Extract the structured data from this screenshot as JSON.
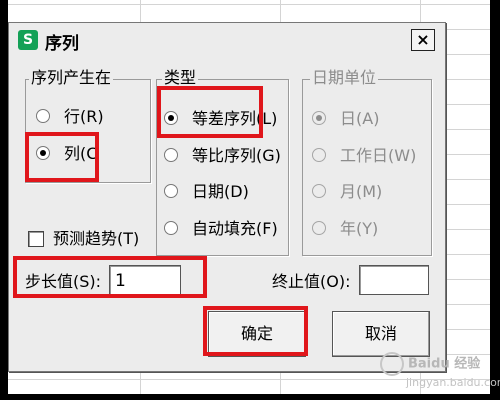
{
  "dialog": {
    "icon_letter": "S",
    "title": "序列",
    "close_glyph": "×"
  },
  "series_in": {
    "legend": "序列产生在",
    "options": [
      {
        "label": "行(R)",
        "checked": false
      },
      {
        "label": "列(C",
        "checked": true
      }
    ]
  },
  "type": {
    "legend": "类型",
    "options": [
      {
        "label": "等差序列(L)",
        "checked": true
      },
      {
        "label": "等比序列(G)",
        "checked": false
      },
      {
        "label": "日期(D)",
        "checked": false
      },
      {
        "label": "自动填充(F)",
        "checked": false
      }
    ]
  },
  "date_unit": {
    "legend": "日期单位",
    "enabled": false,
    "options": [
      {
        "label": "日(A)",
        "checked": true
      },
      {
        "label": "工作日(W)",
        "checked": false
      },
      {
        "label": "月(M)",
        "checked": false
      },
      {
        "label": "年(Y)",
        "checked": false
      }
    ]
  },
  "trend": {
    "label": "预测趋势(T)",
    "checked": false
  },
  "step": {
    "label": "步长值(S):",
    "value": "1"
  },
  "stop": {
    "label": "终止值(O):",
    "value": ""
  },
  "buttons": {
    "ok": "确定",
    "cancel": "取消"
  },
  "watermark": {
    "text": "Baidu 经验",
    "sub": "jingyan.baidu.com"
  },
  "colors": {
    "highlight": "#e0161b",
    "app_icon": "#14a157"
  }
}
